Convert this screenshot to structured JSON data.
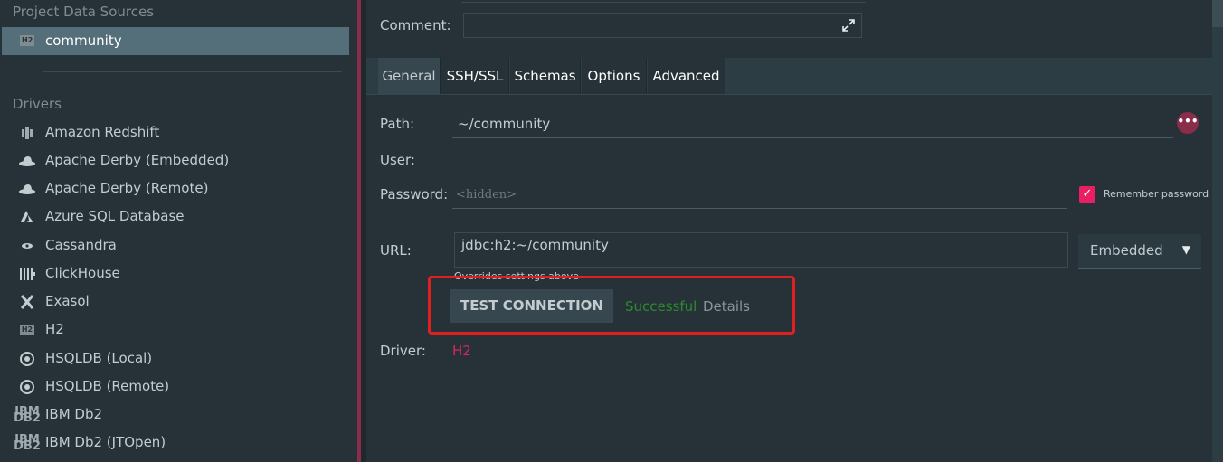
{
  "left_panel": {
    "data_sources_title": "Project Data Sources",
    "selected_source": {
      "badge": "H2",
      "label": "community"
    },
    "drivers_title": "Drivers",
    "drivers": [
      {
        "label": "Amazon Redshift",
        "icon": "redshift-icon"
      },
      {
        "label": "Apache Derby (Embedded)",
        "icon": "derby-hat-icon"
      },
      {
        "label": "Apache Derby (Remote)",
        "icon": "derby-hat-icon"
      },
      {
        "label": "Azure SQL Database",
        "icon": "azure-icon"
      },
      {
        "label": "Cassandra",
        "icon": "cassandra-eye-icon"
      },
      {
        "label": "ClickHouse",
        "icon": "clickhouse-bars-icon"
      },
      {
        "label": "Exasol",
        "icon": "exasol-x-icon"
      },
      {
        "label": "H2",
        "icon": "h2-badge-icon",
        "badge": "H2"
      },
      {
        "label": "HSQLDB (Local)",
        "icon": "hsqldb-icon"
      },
      {
        "label": "HSQLDB (Remote)",
        "icon": "hsqldb-icon"
      },
      {
        "label": "IBM Db2",
        "icon": "ibm-db2-icon",
        "badge": "IBM DB2"
      },
      {
        "label": "IBM Db2 (JTOpen)",
        "icon": "ibm-db2-icon",
        "badge": "IBM DB2"
      }
    ]
  },
  "form": {
    "comment_label": "Comment:",
    "tabs": [
      "General",
      "SSH/SSL",
      "Schemas",
      "Options",
      "Advanced"
    ],
    "active_tab": "General",
    "path_label": "Path:",
    "path_value": "~/community",
    "more_label": "•••",
    "user_label": "User:",
    "user_value": "",
    "password_label": "Password:",
    "password_placeholder": "<hidden>",
    "remember_password_label": "Remember password",
    "remember_password_checked": true,
    "url_label": "URL:",
    "url_value": "jdbc:h2:~/community",
    "url_mode": "Embedded",
    "overrides_note": "Overrides settings above",
    "test_connection_label": "TEST CONNECTION",
    "status_text": "Successful",
    "details_text": "Details",
    "driver_label": "Driver:",
    "driver_value": "H2"
  },
  "colors": {
    "background": "#263238",
    "accent": "#e91e63",
    "success": "#2e8b2e",
    "highlight_box": "#e02020",
    "selected_row": "#546e7a"
  }
}
